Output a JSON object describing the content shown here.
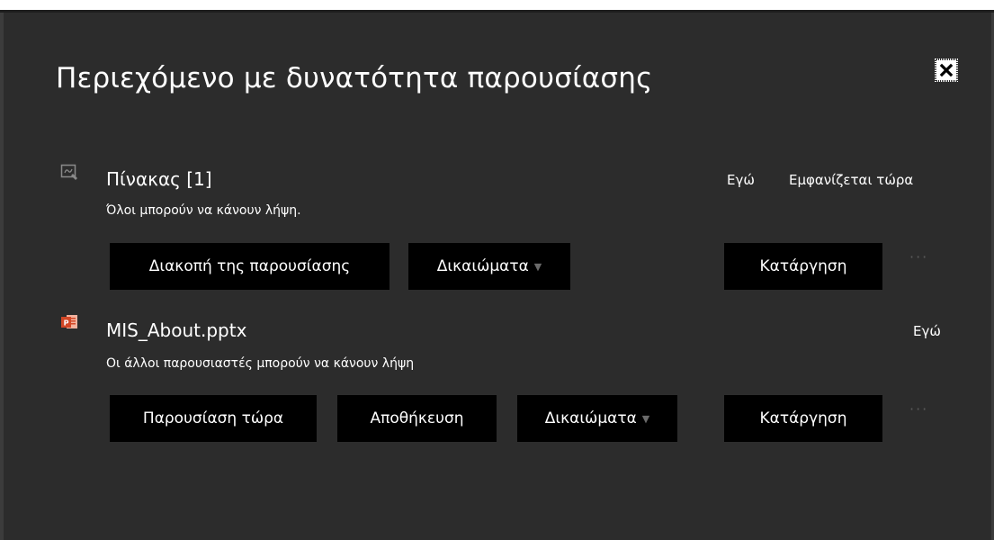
{
  "dialog": {
    "title": "Περιεχόμενο με δυνατότητα παρουσίασης",
    "close_icon": "close-icon"
  },
  "items": [
    {
      "icon": "whiteboard-icon",
      "name": "Πίνακας [1]",
      "subtitle": "Όλοι μπορούν να κάνουν λήψη.",
      "owner": "Εγώ",
      "status": "Εμφανίζεται τώρα",
      "buttons": [
        "Διακοπή της παρουσίασης",
        "Δικαιώματα"
      ],
      "remove_label": "Κατάργηση",
      "more": "···"
    },
    {
      "icon": "powerpoint-icon",
      "name": "MIS_About.pptx",
      "subtitle": "Οι άλλοι παρουσιαστές μπορούν να κάνουν λήψη",
      "owner": "Εγώ",
      "buttons": [
        "Παρουσίαση τώρα",
        "Αποθήκευση",
        "Δικαιώματα"
      ],
      "remove_label": "Κατάργηση",
      "more": "···"
    }
  ],
  "colors": {
    "background": "#2c2c2c",
    "button": "#000000",
    "text": "#ffffff",
    "powerpoint": "#d24726"
  }
}
